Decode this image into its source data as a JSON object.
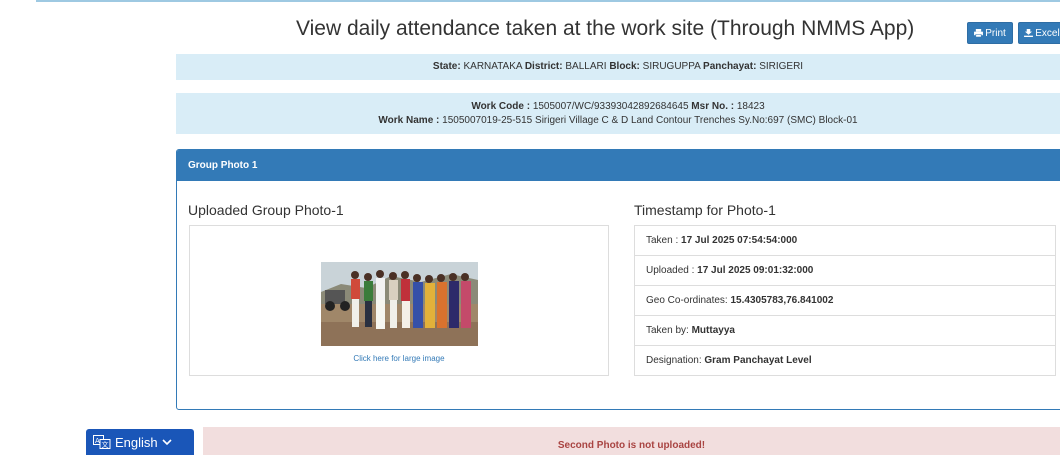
{
  "page": {
    "title": "View daily attendance taken at the work site (Through NMMS App)",
    "print_label": "Print",
    "excel_label": "Excel"
  },
  "location": {
    "state_label": "State:",
    "state": "KARNATAKA",
    "district_label": "District:",
    "district": "BALLARI",
    "block_label": "Block:",
    "block": "SIRUGUPPA",
    "panchayat_label": "Panchayat:",
    "panchayat": "SIRIGERI"
  },
  "work": {
    "code_label": "Work Code :",
    "code": "1505007/WC/93393042892684645",
    "msr_label": "Msr No. :",
    "msr": "18423",
    "name_label": "Work Name :",
    "name": "1505007019-25-515 Sirigeri Village C & D Land Contour Trenches Sy.No:697 (SMC) Block-01"
  },
  "group_photo": {
    "panel_title": "Group Photo 1",
    "uploaded_heading": "Uploaded Group Photo-1",
    "large_image_link": "Click here for large image",
    "timestamp_heading": "Timestamp for Photo-1",
    "taken_label": "Taken :",
    "taken": "17 Jul 2025 07:54:54:000",
    "uploaded_label": "Uploaded :",
    "uploaded": "17 Jul 2025 09:01:32:000",
    "geo_label": "Geo Co-ordinates:",
    "geo": "15.4305783,76.841002",
    "taken_by_label": "Taken by:",
    "taken_by": "Muttayya",
    "designation_label": "Designation:",
    "designation": "Gram Panchayat Level"
  },
  "language": {
    "label": "English"
  },
  "alert": {
    "message": "Second Photo is not uploaded!"
  },
  "colors": {
    "primary": "#337ab7",
    "info_bg": "#d9edf7",
    "danger_bg": "#f2dede",
    "danger_text": "#a94442",
    "lang_bg": "#1a56b8"
  },
  "icons": {
    "print": "printer-icon",
    "excel": "download-icon",
    "translate": "translate-icon",
    "chevron": "chevron-down-icon"
  }
}
